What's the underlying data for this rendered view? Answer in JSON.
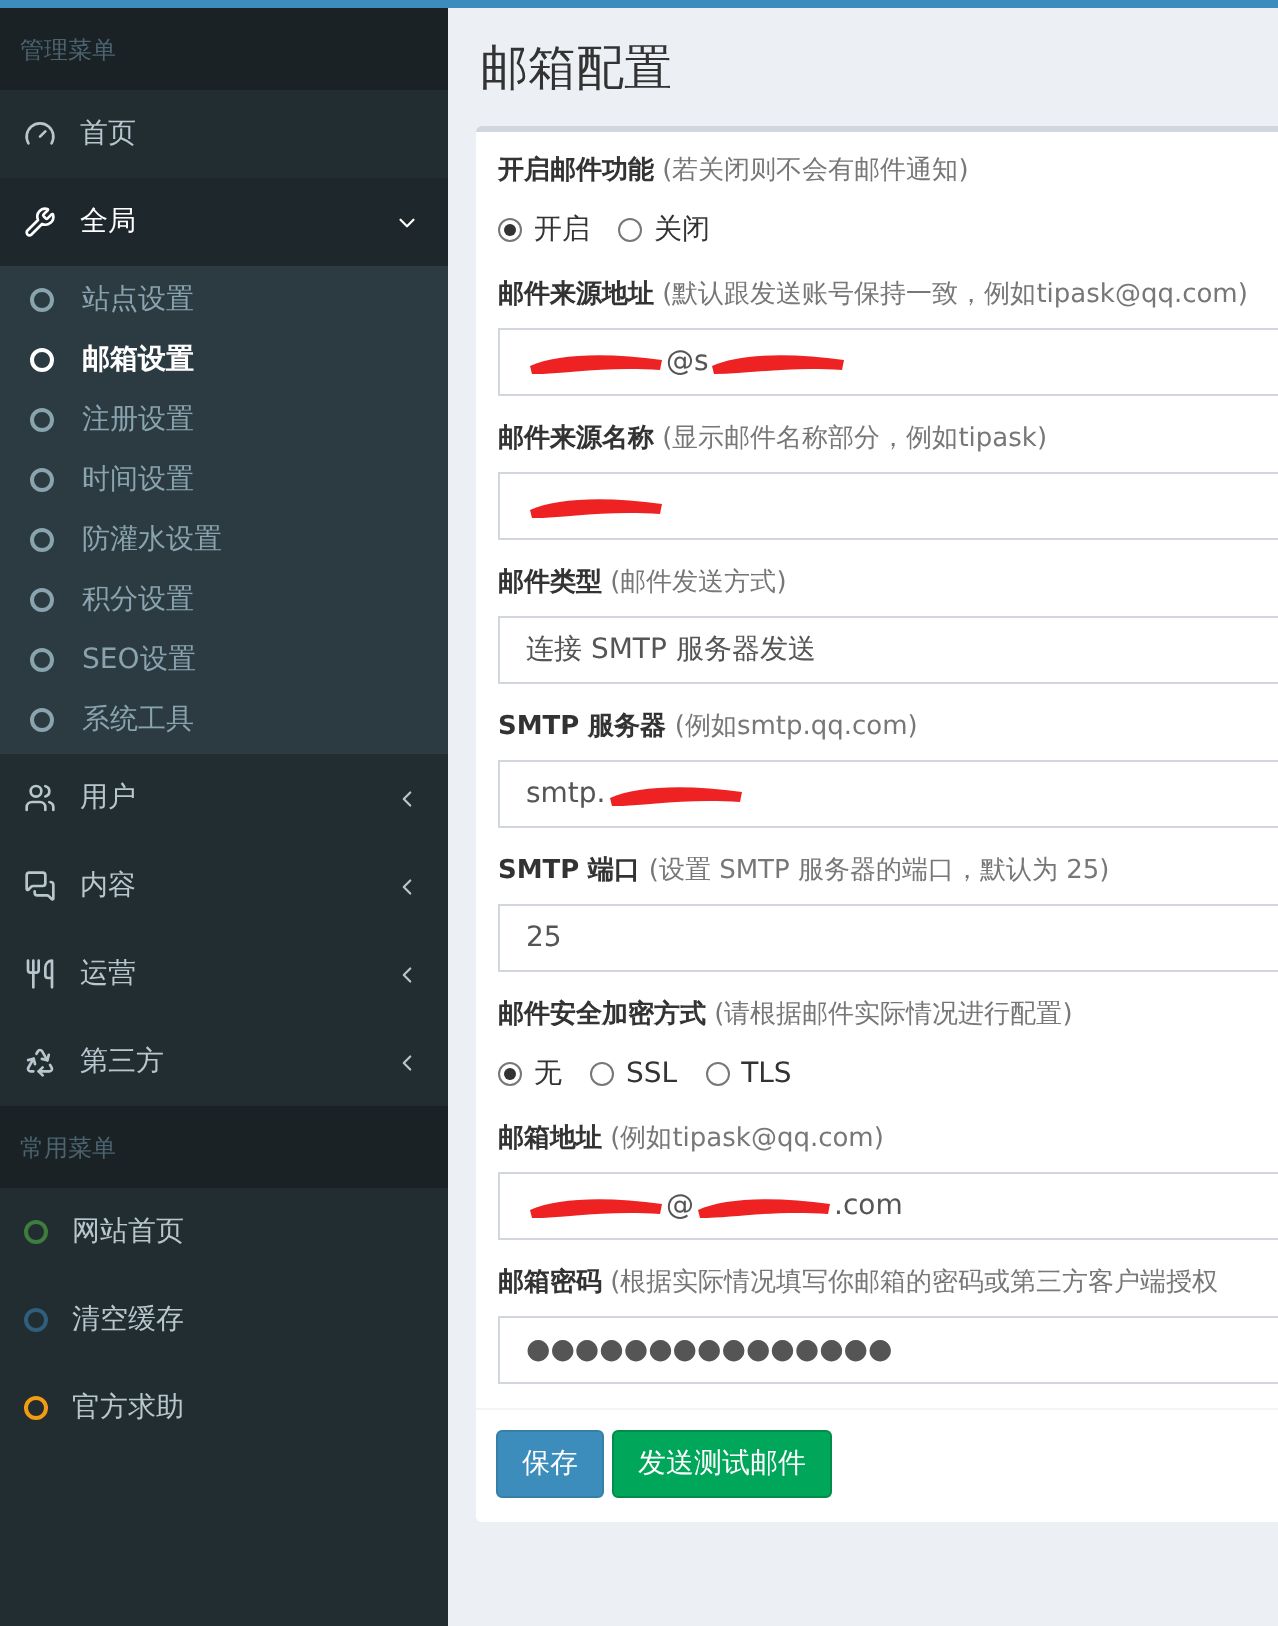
{
  "sidebar": {
    "sections": [
      {
        "header": "管理菜单",
        "items": [
          {
            "kind": "link",
            "label": "首页"
          },
          {
            "kind": "menu",
            "label": "全局",
            "expanded": true,
            "children": [
              {
                "label": "站点设置",
                "selected": false
              },
              {
                "label": "邮箱设置",
                "selected": true
              },
              {
                "label": "注册设置",
                "selected": false
              },
              {
                "label": "时间设置",
                "selected": false
              },
              {
                "label": "防灌水设置",
                "selected": false
              },
              {
                "label": "积分设置",
                "selected": false
              },
              {
                "label": "SEO设置",
                "selected": false
              },
              {
                "label": "系统工具",
                "selected": false
              }
            ]
          },
          {
            "kind": "menu",
            "label": "用户",
            "expanded": false
          },
          {
            "kind": "menu",
            "label": "内容",
            "expanded": false
          },
          {
            "kind": "menu",
            "label": "运营",
            "expanded": false
          },
          {
            "kind": "menu",
            "label": "第三方",
            "expanded": false
          }
        ]
      },
      {
        "header": "常用菜单",
        "items": [
          {
            "kind": "dot",
            "label": "网站首页",
            "color": "#3e7d3e"
          },
          {
            "kind": "dot",
            "label": "清空缓存",
            "color": "#2f5f7c"
          },
          {
            "kind": "dot",
            "label": "官方求助",
            "color": "#f39c12"
          }
        ]
      }
    ]
  },
  "page_title": "邮箱配置",
  "form": [
    {
      "kind": "radio",
      "label": "开启邮件功能",
      "hint": "(若关闭则不会有邮件通知)",
      "options": [
        {
          "label": "开启",
          "selected": true
        },
        {
          "label": "关闭",
          "selected": false
        }
      ]
    },
    {
      "kind": "text",
      "label": "邮件来源地址",
      "hint": "(默认跟发送账号保持一致，例如tipask@qq.com)",
      "segments": [
        {
          "kind": "redaction"
        },
        {
          "kind": "text",
          "text": "@s"
        },
        {
          "kind": "redaction"
        }
      ]
    },
    {
      "kind": "text",
      "label": "邮件来源名称",
      "hint": "(显示邮件名称部分，例如tipask)",
      "segments": [
        {
          "kind": "redaction"
        }
      ]
    },
    {
      "kind": "select",
      "label": "邮件类型",
      "hint": "(邮件发送方式)",
      "value": "连接 SMTP 服务器发送"
    },
    {
      "kind": "text",
      "label": "SMTP 服务器",
      "hint": "(例如smtp.qq.com)",
      "segments": [
        {
          "kind": "text",
          "text": "smtp."
        },
        {
          "kind": "redaction"
        }
      ]
    },
    {
      "kind": "text",
      "label": "SMTP 端口",
      "hint": "(设置 SMTP 服务器的端口，默认为 25)",
      "segments": [
        {
          "kind": "text",
          "text": "25"
        }
      ]
    },
    {
      "kind": "radio",
      "label": "邮件安全加密方式",
      "hint": "(请根据邮件实际情况进行配置)",
      "options": [
        {
          "label": "无",
          "selected": true
        },
        {
          "label": "SSL",
          "selected": false
        },
        {
          "label": "TLS",
          "selected": false
        }
      ]
    },
    {
      "kind": "text",
      "label": "邮箱地址",
      "hint": "(例如tipask@qq.com)",
      "segments": [
        {
          "kind": "redaction"
        },
        {
          "kind": "text",
          "text": "@"
        },
        {
          "kind": "redaction"
        },
        {
          "kind": "text",
          "text": ".com"
        }
      ]
    },
    {
      "kind": "text",
      "label": "邮箱密码",
      "hint": "(根据实际情况填写你邮箱的密码或第三方客户端授权",
      "segments": [
        {
          "kind": "text",
          "text": "●●●●●●●●●●●●●●●"
        }
      ]
    }
  ],
  "buttons": [
    {
      "kind": "primary",
      "label": "保存"
    },
    {
      "kind": "success",
      "label": "发送测试邮件"
    }
  ]
}
